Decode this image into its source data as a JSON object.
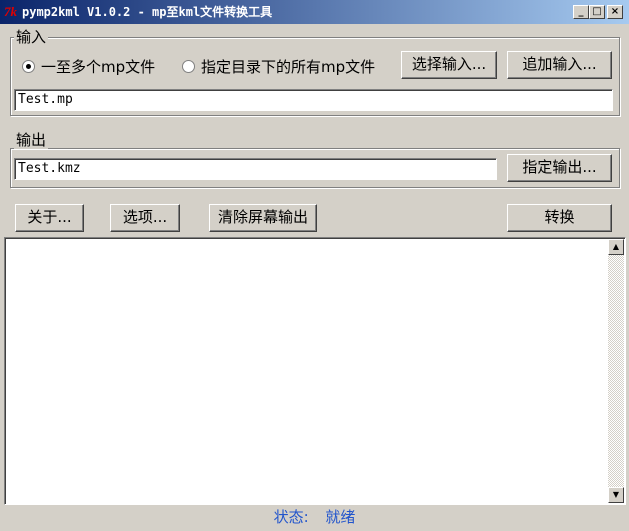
{
  "window": {
    "icon": "tk-feather-icon",
    "icon_glyph": "7k",
    "title": "pymp2kml V1.0.2 - mp至kml文件转换工具",
    "minimize": "_",
    "maximize": "□",
    "close": "×"
  },
  "input_group": {
    "legend": "输入",
    "radio_single": {
      "label": "一至多个mp文件",
      "selected": true
    },
    "radio_dir": {
      "label": "指定目录下的所有mp文件",
      "selected": false
    },
    "select_input_label": "选择输入...",
    "append_input_label": "追加输入...",
    "path_value": "Test.mp"
  },
  "output_group": {
    "legend": "输出",
    "path_value": "Test.kmz",
    "set_output_label": "指定输出..."
  },
  "actions": {
    "about_label": "关于...",
    "options_label": "选项...",
    "clear_label": "清除屏幕输出",
    "convert_label": "转换"
  },
  "scroll": {
    "up": "▲",
    "down": "▼"
  },
  "status": {
    "label": "状态:",
    "value": "就绪"
  },
  "colors": {
    "title_start": "#0a246a",
    "title_end": "#a6caf0",
    "status_text": "#2255cc",
    "face": "#d4d0c8"
  }
}
